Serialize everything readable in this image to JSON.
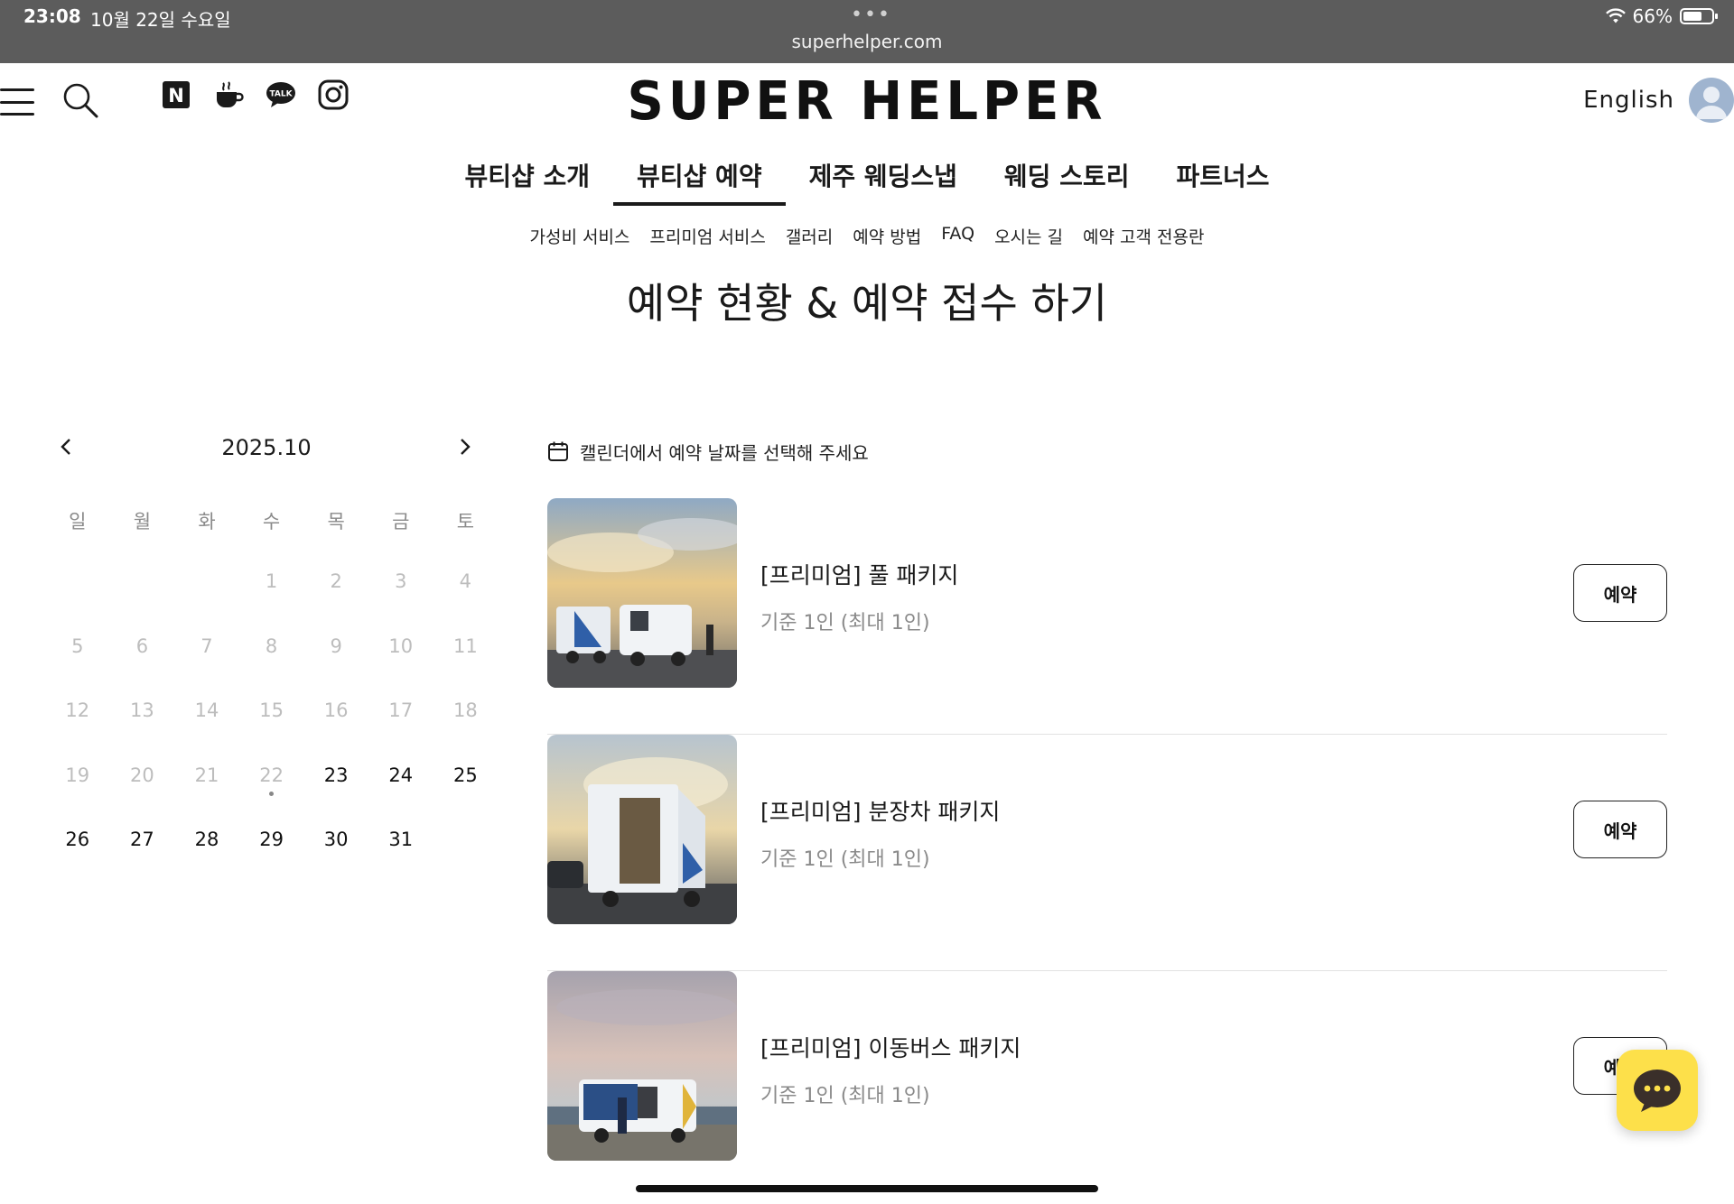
{
  "status_bar": {
    "time": "23:08",
    "date": "10월 22일 수요일",
    "dots": "•••",
    "url": "superhelper.com",
    "battery_text": "66%",
    "battery_level": 0.66
  },
  "header": {
    "logo": "SUPER HELPER",
    "language": "English",
    "social_icons": [
      "naver-icon",
      "cafe-icon",
      "kakaotalk-icon",
      "instagram-icon"
    ],
    "naver_glyph": "N",
    "talk_glyph": "TALK"
  },
  "main_nav": [
    {
      "label": "뷰티샵 소개"
    },
    {
      "label": "뷰티샵 예약"
    },
    {
      "label": "제주 웨딩스냅"
    },
    {
      "label": "웨딩 스토리"
    },
    {
      "label": "파트너스"
    }
  ],
  "active_tab": "뷰티샵 예약",
  "sub_nav": [
    "가성비 서비스",
    "프리미엄 서비스",
    "갤러리",
    "예약 방법",
    "FAQ",
    "오시는 길",
    "예약 고객 전용란"
  ],
  "page_title": "예약 현황 & 예약 접수 하기",
  "calendar": {
    "month": "2025.10",
    "prev": "‹",
    "next": "›",
    "weekdays": [
      "일",
      "월",
      "화",
      "수",
      "목",
      "금",
      "토"
    ],
    "today": 22,
    "first_available": 23,
    "weeks": [
      [
        "",
        "",
        "",
        "1",
        "2",
        "3",
        "4"
      ],
      [
        "5",
        "6",
        "7",
        "8",
        "9",
        "10",
        "11"
      ],
      [
        "12",
        "13",
        "14",
        "15",
        "16",
        "17",
        "18"
      ],
      [
        "19",
        "20",
        "21",
        "22",
        "23",
        "24",
        "25"
      ],
      [
        "26",
        "27",
        "28",
        "29",
        "30",
        "31",
        ""
      ]
    ]
  },
  "booking": {
    "hint": "캘린더에서 예약 날짜를 선택해 주세요",
    "items": [
      {
        "name": "[프리미엄] 풀 패키지",
        "sub": "기준 1인 (최대 1인)",
        "button": "예약"
      },
      {
        "name": "[프리미엄] 분장차 패키지",
        "sub": "기준 1인 (최대 1인)",
        "button": "예약"
      },
      {
        "name": "[프리미엄] 이동버스 패키지",
        "sub": "기준 1인 (최대 1인)",
        "button": "예약"
      }
    ]
  },
  "colors": {
    "status_bar": "#5c5c5c",
    "chat_fab": "#fde04a",
    "text": "#1a1a1a",
    "muted": "#8a8a8a"
  }
}
